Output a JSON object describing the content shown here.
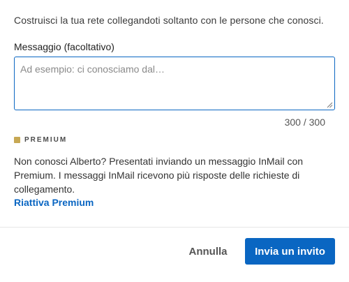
{
  "intro_text": "Costruisci la tua rete collegandoti soltanto con le persone che conosci.",
  "message": {
    "label": "Messaggio (facoltativo)",
    "value": "",
    "placeholder": "Ad esempio: ci conosciamo dal…",
    "counter": "300 / 300"
  },
  "premium": {
    "badge_label": "PREMIUM",
    "badge_color": "#c7a854",
    "description": "Non conosci Alberto? Presentati inviando un messaggio InMail con Premium. I messaggi InMail ricevono più risposte delle richieste di collegamento.",
    "link_label": "Riattiva Premium"
  },
  "actions": {
    "cancel_label": "Annulla",
    "send_label": "Invia un invito"
  },
  "colors": {
    "accent": "#0a66c2"
  }
}
